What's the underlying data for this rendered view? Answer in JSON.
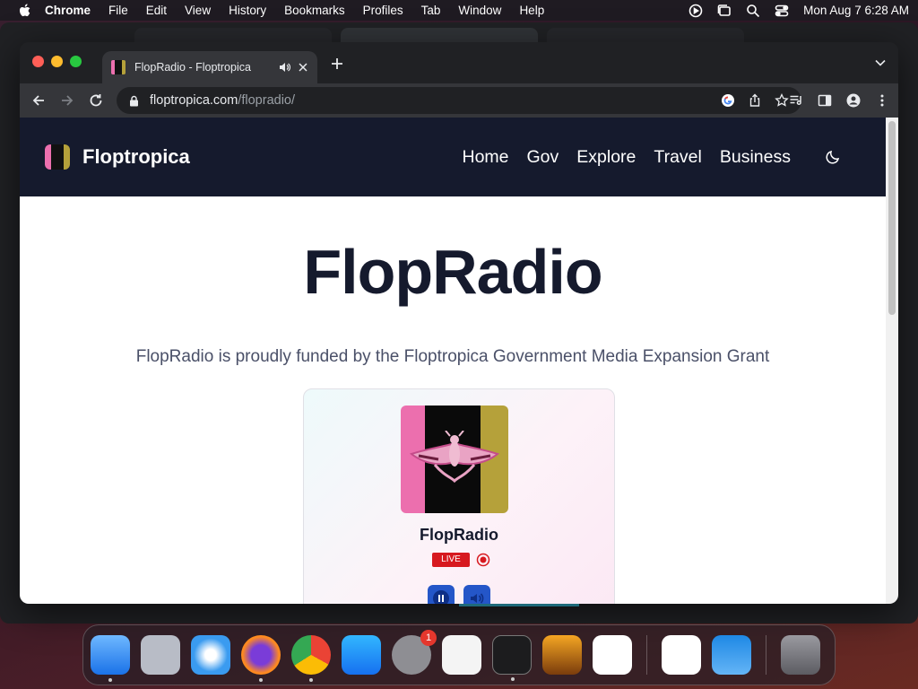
{
  "menubar": {
    "app": "Chrome",
    "items": [
      "File",
      "Edit",
      "View",
      "History",
      "Bookmarks",
      "Profiles",
      "Tab",
      "Window",
      "Help"
    ],
    "clock": "Mon Aug 7  6:28 AM"
  },
  "browser": {
    "tab_title": "FlopRadio - Floptropica",
    "url_host": "floptropica.com",
    "url_path": "/flopradio/"
  },
  "site": {
    "brand": "Floptropica",
    "nav": [
      "Home",
      "Gov",
      "Explore",
      "Travel",
      "Business"
    ]
  },
  "page": {
    "title": "FlopRadio",
    "subtitle": "FlopRadio is proudly funded by the Floptropica Government Media Expansion Grant"
  },
  "player": {
    "station": "FlopRadio",
    "live_label": "LIVE"
  },
  "dock": {
    "apps": [
      "finder-icon",
      "launchpad-icon",
      "safari-icon",
      "firefox-icon",
      "chrome-icon",
      "app-store-icon",
      "system-settings-icon",
      "textedit-icon",
      "terminal-icon",
      "garageband-icon",
      "vscode-icon",
      "visual-studio-icon",
      "weather-icon",
      "trash-icon"
    ],
    "settings_badge": "1"
  },
  "colors": {
    "header_bg": "#151a2d",
    "live_red": "#d7191f",
    "control_blue": "#2456c8",
    "logo_pink": "#ec6fae",
    "logo_gold": "#b5a13a"
  }
}
